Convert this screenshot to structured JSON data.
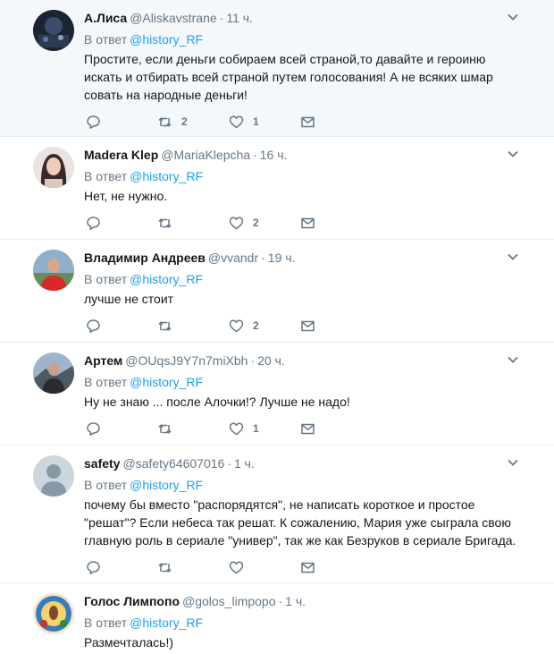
{
  "reply_prefix": "В ответ",
  "tweets": [
    {
      "name": "А.Лиса",
      "handle": "@Aliskavstrane",
      "time": "11 ч.",
      "reply_to": "@history_RF",
      "text": "Простите, если деньги собираем всей страной,то давайте и героиню искать и отбирать всей страной путем голосования! А не всяких шмар совать на народные деньги!",
      "retweets": "2",
      "likes": "1",
      "highlight": true
    },
    {
      "name": "Madera Klep",
      "handle": "@MariaKlepcha",
      "time": "16 ч.",
      "reply_to": "@history_RF",
      "text": "Нет, не нужно.",
      "retweets": "",
      "likes": "2",
      "highlight": false
    },
    {
      "name": "Владимир Андреев",
      "handle": "@vvandr",
      "time": "19 ч.",
      "reply_to": "@history_RF",
      "text": "лучше не стоит",
      "retweets": "",
      "likes": "2",
      "highlight": false
    },
    {
      "name": "Артем",
      "handle": "@OUqsJ9Y7n7miXbh",
      "time": "20 ч.",
      "reply_to": "@history_RF",
      "text": "Ну не знаю ... после Алочки!? Лучше не надо!",
      "retweets": "",
      "likes": "1",
      "highlight": false
    },
    {
      "name": "safety",
      "handle": "@safety64607016",
      "time": "1 ч.",
      "reply_to": "@history_RF",
      "text": "почему бы вместо \"распорядятся\", не написать короткое и простое \"решат\"? Если небеса так решат. К сожалению, Мария уже сыграла свою главную роль в сериале \"универ\", так же как Безруков в сериале Бригада.",
      "retweets": "",
      "likes": "",
      "highlight": false
    },
    {
      "name": "Голос Лимпопо",
      "handle": "@golos_limpopo",
      "time": "1 ч.",
      "reply_to": "@history_RF",
      "text": "Размечталась!)",
      "retweets": "",
      "likes": "",
      "highlight": false
    }
  ]
}
